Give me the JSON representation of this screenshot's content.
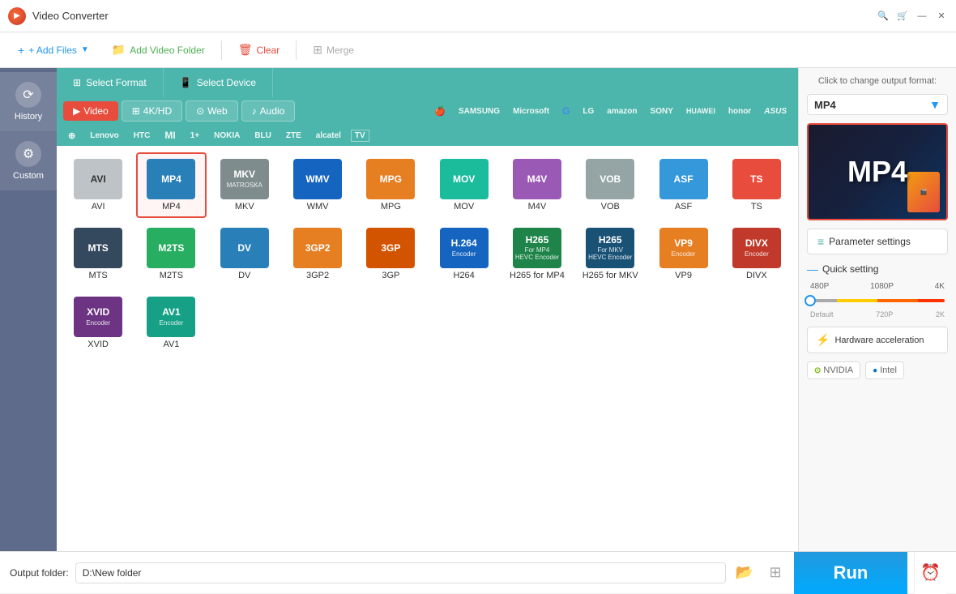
{
  "app": {
    "title": "Video Converter",
    "icon": "▶"
  },
  "toolbar": {
    "add_files": "+ Add Files",
    "add_folder": "Add Video Folder",
    "clear": "Clear",
    "merge": "Merge"
  },
  "sidebar": {
    "history_label": "History",
    "custom_label": "Custom"
  },
  "format_tabs": {
    "select_format": "Select Format",
    "select_device": "Select Device"
  },
  "categories": {
    "video": "Video",
    "video_4k": "4K/HD",
    "web": "Web",
    "audio": "Audio"
  },
  "device_row1": [
    "🍎",
    "SAMSUNG",
    "Microsoft",
    "G",
    "LG",
    "amazon",
    "SONY",
    "HUAWEI",
    "honor",
    "ASUS"
  ],
  "device_row2": [
    "M",
    "Lenovo",
    "HTC",
    "MI",
    "1+",
    "NOKIA",
    "BLU",
    "ZTE",
    "alcatel",
    "TV"
  ],
  "formats": [
    {
      "id": "avi",
      "label": "AVI",
      "class": "fmt-avi",
      "selected": false
    },
    {
      "id": "mp4",
      "label": "MP4",
      "class": "fmt-mp4",
      "selected": true
    },
    {
      "id": "mkv",
      "label": "MKV",
      "class": "fmt-mkv",
      "selected": false
    },
    {
      "id": "wmv",
      "label": "WMV",
      "class": "fmt-wmv",
      "selected": false
    },
    {
      "id": "mpg",
      "label": "MPG",
      "class": "fmt-mpg",
      "selected": false
    },
    {
      "id": "mov",
      "label": "MOV",
      "class": "fmt-mov",
      "selected": false
    },
    {
      "id": "m4v",
      "label": "M4V",
      "class": "fmt-m4v",
      "selected": false
    },
    {
      "id": "vob",
      "label": "VOB",
      "class": "fmt-vob",
      "selected": false
    },
    {
      "id": "asf",
      "label": "ASF",
      "class": "fmt-asf",
      "selected": false
    },
    {
      "id": "ts",
      "label": "TS",
      "class": "fmt-ts",
      "selected": false
    },
    {
      "id": "mts",
      "label": "MTS",
      "class": "fmt-mts",
      "selected": false
    },
    {
      "id": "m2ts",
      "label": "M2TS",
      "class": "fmt-m2ts",
      "selected": false
    },
    {
      "id": "dv",
      "label": "DV",
      "class": "fmt-dv",
      "selected": false
    },
    {
      "id": "3gp2",
      "label": "3GP2",
      "class": "fmt-3gp2",
      "selected": false
    },
    {
      "id": "3gp",
      "label": "3GP",
      "class": "fmt-3gp",
      "selected": false
    },
    {
      "id": "h264",
      "label": "H264",
      "class": "fmt-h264",
      "selected": false
    },
    {
      "id": "h265mp4",
      "label": "H265 for MP4",
      "class": "fmt-h265mp4",
      "selected": false
    },
    {
      "id": "h265mkv",
      "label": "H265 for MKV",
      "class": "fmt-h265mkv",
      "selected": false
    },
    {
      "id": "vp9",
      "label": "VP9",
      "class": "fmt-vp9",
      "selected": false
    },
    {
      "id": "divx",
      "label": "DIVX",
      "class": "fmt-divx",
      "selected": false
    },
    {
      "id": "xvid",
      "label": "XVID",
      "class": "fmt-xvid",
      "selected": false
    },
    {
      "id": "av1",
      "label": "AV1",
      "class": "fmt-av1",
      "selected": false
    }
  ],
  "right_panel": {
    "hint": "Click to change output format:",
    "selected_format": "MP4",
    "param_settings": "Parameter settings",
    "quick_setting": "Quick setting",
    "quality_labels": [
      "480P",
      "1080P",
      "4K"
    ],
    "quality_marks": [
      "Default",
      "720P",
      "2K"
    ],
    "hw_accel": "Hardware acceleration",
    "nvidia_label": "NVIDIA",
    "intel_label": "Intel"
  },
  "bottom": {
    "output_label": "Output folder:",
    "folder_path": "D:\\New folder",
    "run_label": "Run"
  }
}
